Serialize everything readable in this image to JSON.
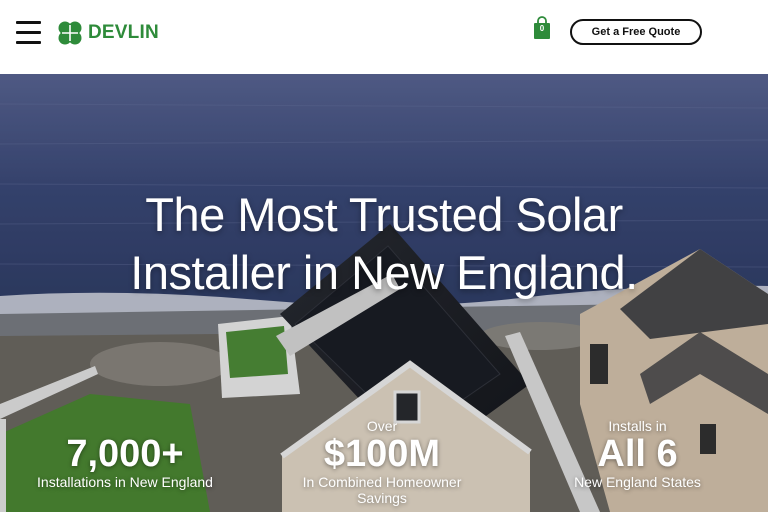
{
  "header": {
    "logo_text": "DEVLIN",
    "cart_count": "0",
    "quote_button": "Get a Free Quote"
  },
  "hero": {
    "title_line1": "The Most Trusted Solar",
    "title_line2": "Installer in New England.",
    "stats": [
      {
        "pre": "",
        "value": "7,000+",
        "label": "Installations in New England"
      },
      {
        "pre": "Over",
        "value": "$100M",
        "label": "In Combined Homeowner Savings"
      },
      {
        "pre": "Installs in",
        "value": "All 6",
        "label": "New England States"
      }
    ]
  },
  "colors": {
    "brand_green": "#2e8b3a",
    "ocean": "#3f4f80",
    "text_on_hero": "#ffffff"
  },
  "icons": [
    "menu-icon",
    "clover-logo-icon",
    "shopping-bag-icon"
  ]
}
